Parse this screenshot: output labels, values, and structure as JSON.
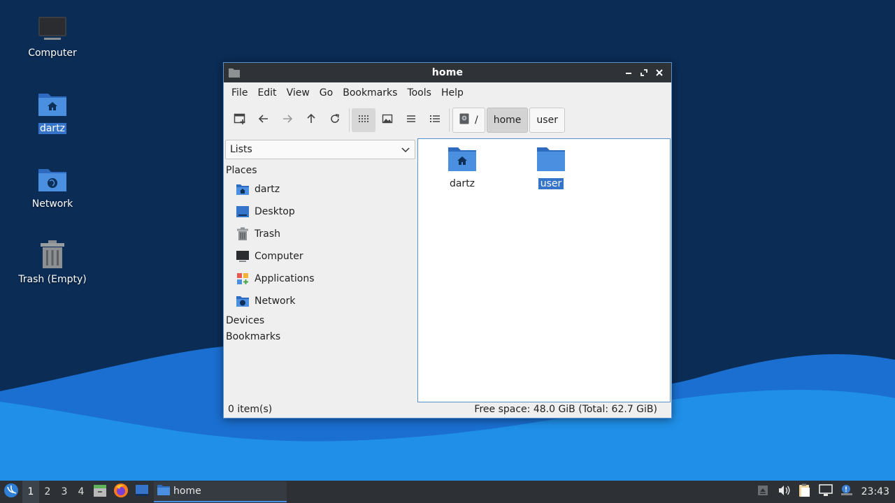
{
  "desktop": {
    "icons": [
      {
        "label": "Computer"
      },
      {
        "label": "dartz"
      },
      {
        "label": "Network"
      },
      {
        "label": "Trash (Empty)"
      }
    ]
  },
  "window": {
    "title": "home",
    "menu": [
      "File",
      "Edit",
      "View",
      "Go",
      "Bookmarks",
      "Tools",
      "Help"
    ],
    "breadcrumb": [
      "/",
      "home",
      "user"
    ],
    "sidepane": {
      "selector": "Lists",
      "places_header": "Places",
      "places": [
        "dartz",
        "Desktop",
        "Trash",
        "Computer",
        "Applications",
        "Network"
      ],
      "devices_header": "Devices",
      "bookmarks_header": "Bookmarks"
    },
    "files": [
      {
        "name": "dartz"
      },
      {
        "name": "user"
      }
    ],
    "status": {
      "items": "0 item(s)",
      "space": "Free space: 48.0 GiB (Total: 62.7 GiB)"
    }
  },
  "taskbar": {
    "workspaces": [
      "1",
      "2",
      "3",
      "4"
    ],
    "task_label": "home",
    "clock": "23:43"
  },
  "colors": {
    "accent": "#3574c8",
    "titlebar": "#2f3338",
    "taskbar": "#2d3136",
    "wallpaper_dark": "#0b2c55",
    "wallpaper_light": "#1f8fe8"
  }
}
